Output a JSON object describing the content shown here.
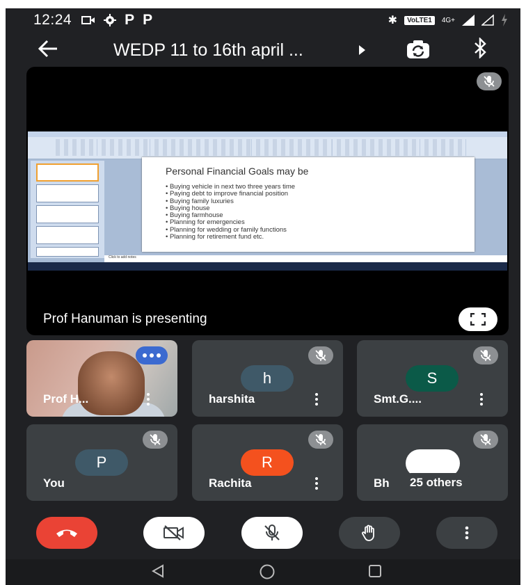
{
  "status_bar": {
    "time": "12:24",
    "left_icons": [
      "P",
      "P"
    ],
    "network_badge": "VoLTE1",
    "network_type": "4G+"
  },
  "header": {
    "title": "WEDP 11 to 16th april ..."
  },
  "presentation": {
    "slide_title": "Personal Financial Goals may be",
    "bullets": [
      "Buying vehicle in next two three years time",
      "Paying debt to improve financial position",
      "Buying family luxuries",
      "Buying house",
      "Buying farmhouse",
      "Planning for emergencies",
      "Planning for wedding or family functions",
      "Planning for retirement fund etc."
    ],
    "notes_placeholder": "Click to add notes",
    "presenting_label": "Prof Hanuman is presenting"
  },
  "participants": {
    "prof": {
      "name": "Prof H..."
    },
    "harshita": {
      "name": "harshita",
      "initial": "h",
      "color": "#3f5968"
    },
    "smt": {
      "name": "Smt.G....",
      "initial": "S",
      "color": "#0b5a48"
    },
    "you": {
      "name": "You",
      "initial": "P",
      "color": "#3f5968"
    },
    "rachita": {
      "name": "Rachita",
      "initial": "R",
      "color": "#f4511e"
    },
    "others": {
      "name": "Bh",
      "count_label": "25 others"
    }
  },
  "colors": {
    "background": "#202124",
    "tile": "#3c4043",
    "end_call": "#ea4335",
    "active_speaker": "#3b6ad0"
  },
  "icons": [
    "back-arrow-icon",
    "switch-camera-icon",
    "bluetooth-icon",
    "mic-off-icon",
    "fullscreen-icon",
    "end-call-icon",
    "camera-off-icon",
    "raise-hand-icon",
    "more-vert-icon"
  ]
}
